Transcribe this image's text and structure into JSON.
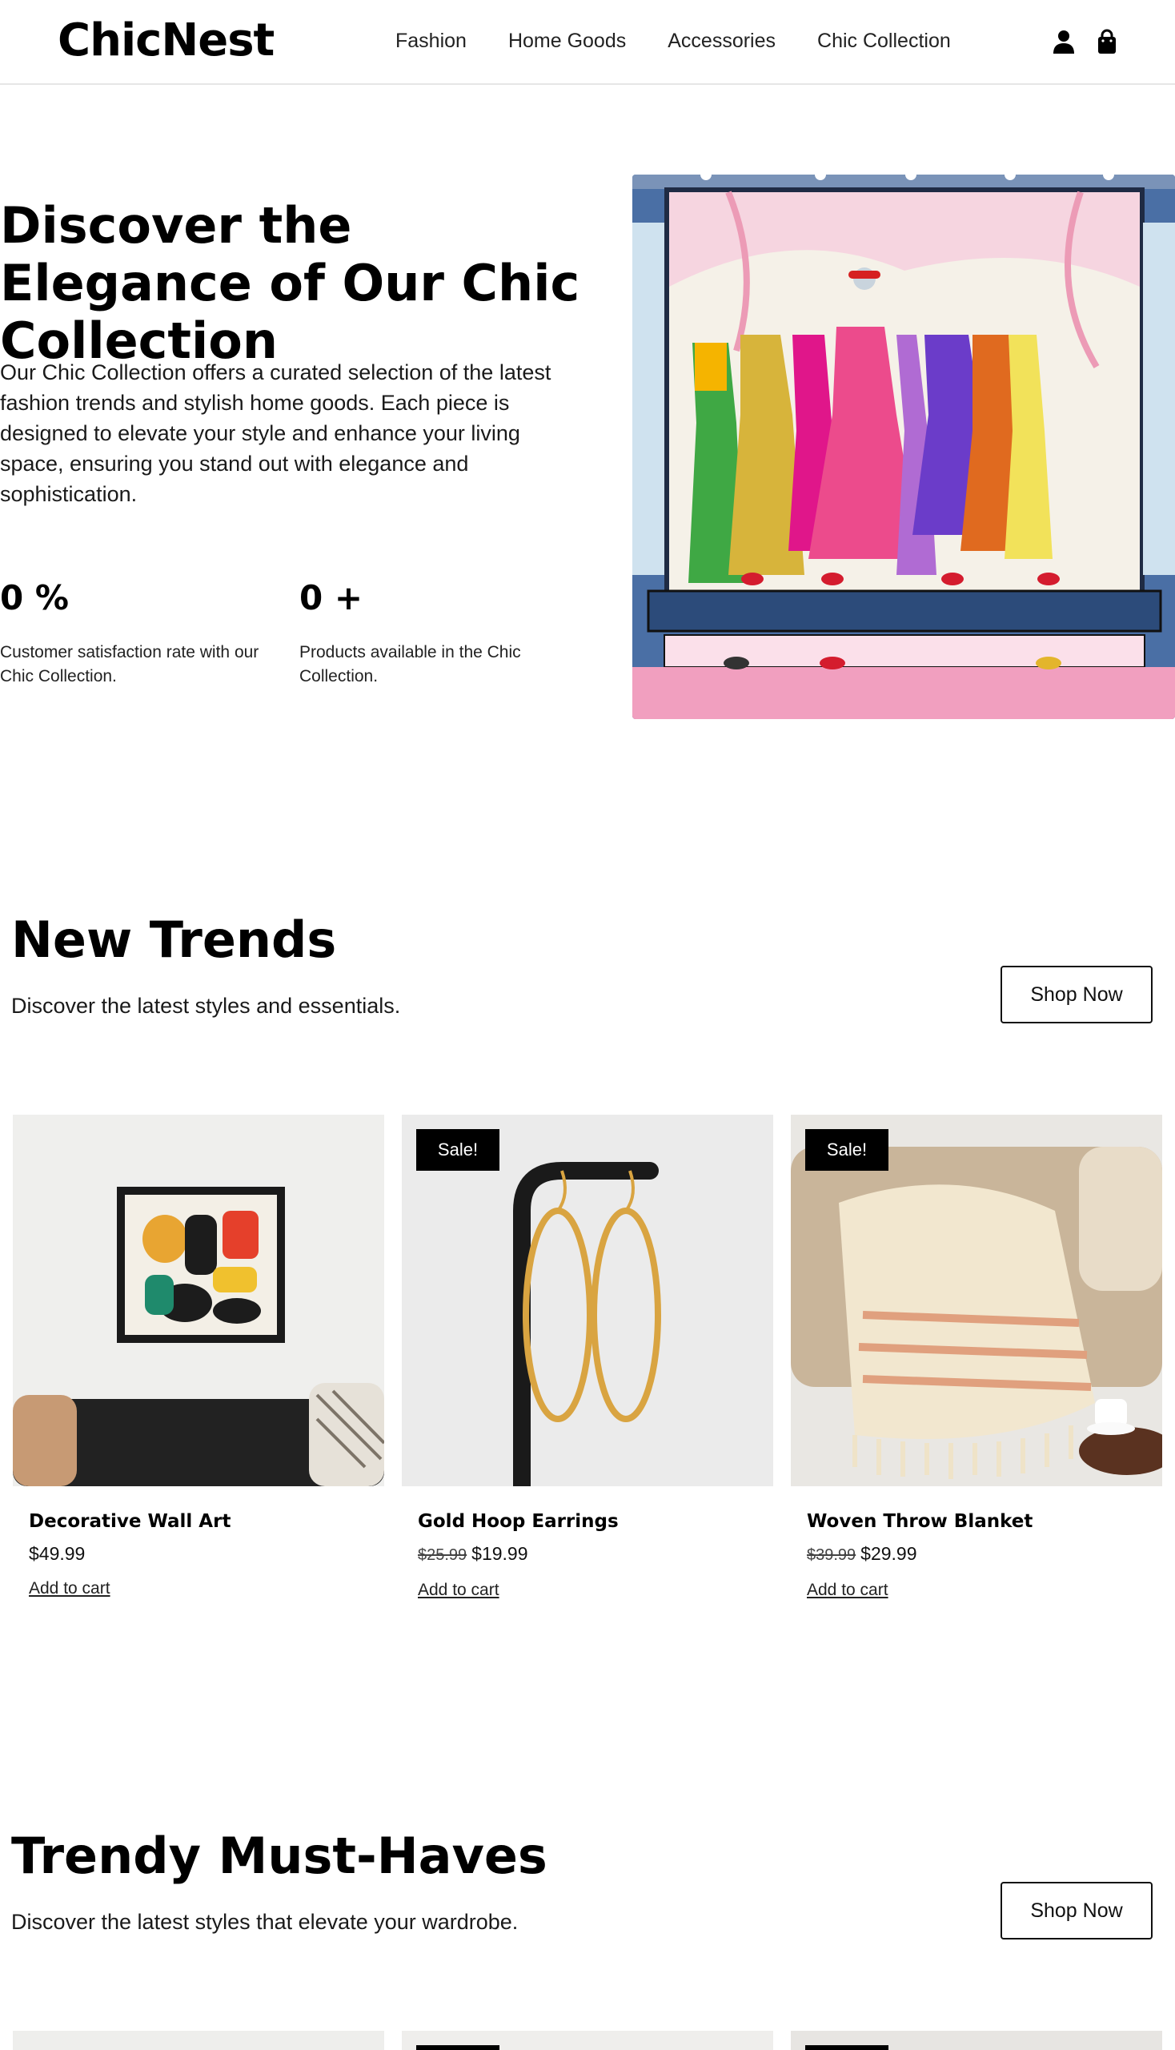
{
  "header": {
    "logo": "ChicNest",
    "nav": [
      "Fashion",
      "Home Goods",
      "Accessories",
      "Chic Collection"
    ],
    "icons": [
      "user-icon",
      "shopping-bag-icon"
    ]
  },
  "hero": {
    "title": "Discover the Elegance of Our Chic Collection",
    "description": "Our Chic Collection offers a curated selection of the latest fashion trends and stylish home goods. Each piece is designed to elevate your style and enhance your living space, ensuring you stand out with elegance and sophistication.",
    "stats": [
      {
        "value": "0 %",
        "label": "Customer satisfaction rate with our Chic Collection."
      },
      {
        "value": "0 +",
        "label": "Products available in the Chic Collection."
      }
    ]
  },
  "new_trends": {
    "title": "New Trends",
    "subtitle": "Discover the latest styles and essentials.",
    "button": "Shop Now",
    "products": [
      {
        "name": "Decorative Wall Art",
        "old_price": "",
        "price": "$49.99",
        "badge": "",
        "cta": "Add to cart"
      },
      {
        "name": "Gold Hoop Earrings",
        "old_price": "$25.99",
        "price": "$19.99",
        "badge": "Sale!",
        "cta": "Add to cart"
      },
      {
        "name": "Woven Throw Blanket",
        "old_price": "$39.99",
        "price": "$29.99",
        "badge": "Sale!",
        "cta": "Add to cart"
      }
    ]
  },
  "must_haves": {
    "title": "Trendy Must-Haves",
    "subtitle": "Discover the latest styles that elevate your wardrobe.",
    "button": "Shop Now"
  },
  "colors": {
    "text": "#111111",
    "badge_bg": "#000000",
    "divider": "#e6e6e6"
  }
}
